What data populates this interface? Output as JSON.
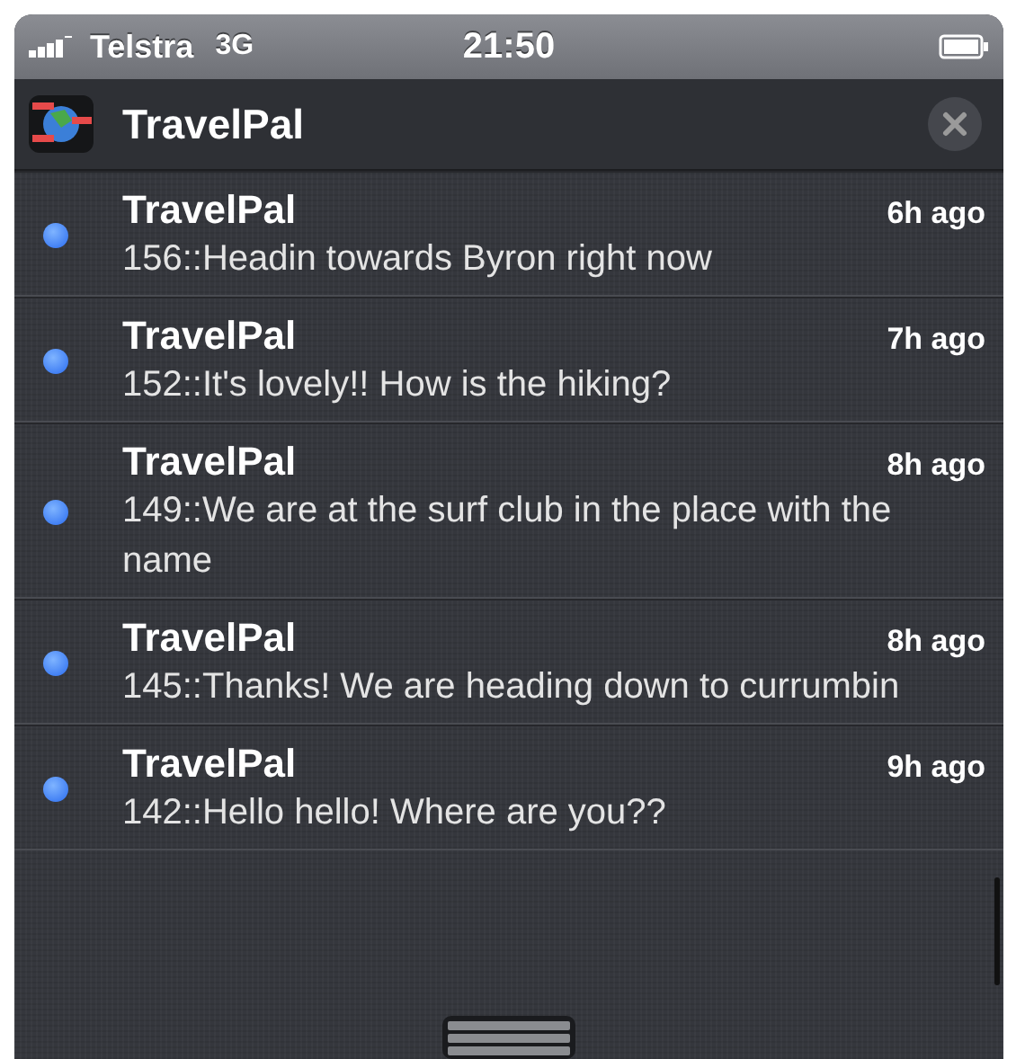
{
  "status_bar": {
    "carrier": "Telstra",
    "network": "3G",
    "time": "21:50"
  },
  "app_header": {
    "title": "TravelPal"
  },
  "notifications": [
    {
      "title": "TravelPal",
      "time": "6h ago",
      "message": "156::Headin towards Byron right now",
      "unread": true
    },
    {
      "title": "TravelPal",
      "time": "7h ago",
      "message": "152::It's lovely!! How is the hiking?",
      "unread": true
    },
    {
      "title": "TravelPal",
      "time": "8h ago",
      "message": "149::We are at the surf club in the place with the name",
      "unread": true
    },
    {
      "title": "TravelPal",
      "time": "8h ago",
      "message": "145::Thanks! We are heading down to currumbin",
      "unread": true
    },
    {
      "title": "TravelPal",
      "time": "9h ago",
      "message": "142::Hello hello! Where are you??",
      "unread": true
    }
  ]
}
